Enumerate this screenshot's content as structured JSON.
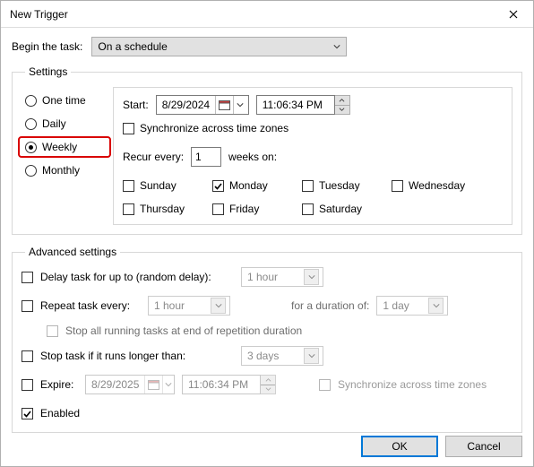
{
  "window": {
    "title": "New Trigger"
  },
  "begin": {
    "label": "Begin the task:",
    "value": "On a schedule"
  },
  "settings": {
    "legend": "Settings",
    "freq": {
      "one_time": "One time",
      "daily": "Daily",
      "weekly": "Weekly",
      "monthly": "Monthly",
      "selected": "weekly"
    },
    "start": {
      "label": "Start:",
      "date": "8/29/2024",
      "time": "11:06:34 PM",
      "sync_label": "Synchronize across time zones",
      "sync_checked": false
    },
    "recur": {
      "label_prefix": "Recur every:",
      "value": "1",
      "label_suffix": "weeks on:"
    },
    "days": {
      "sunday": {
        "label": "Sunday",
        "checked": false
      },
      "monday": {
        "label": "Monday",
        "checked": true
      },
      "tuesday": {
        "label": "Tuesday",
        "checked": false
      },
      "wednesday": {
        "label": "Wednesday",
        "checked": false
      },
      "thursday": {
        "label": "Thursday",
        "checked": false
      },
      "friday": {
        "label": "Friday",
        "checked": false
      },
      "saturday": {
        "label": "Saturday",
        "checked": false
      }
    }
  },
  "advanced": {
    "legend": "Advanced settings",
    "delay": {
      "label": "Delay task for up to (random delay):",
      "value": "1 hour",
      "checked": false
    },
    "repeat": {
      "label": "Repeat task every:",
      "value": "1 hour",
      "checked": false,
      "duration_label": "for a duration of:",
      "duration_value": "1 day"
    },
    "stop_end": {
      "label": "Stop all running tasks at end of repetition duration",
      "checked": false
    },
    "stop_if": {
      "label": "Stop task if it runs longer than:",
      "value": "3 days",
      "checked": false
    },
    "expire": {
      "label": "Expire:",
      "date": "8/29/2025",
      "time": "11:06:34 PM",
      "checked": false,
      "sync_label": "Synchronize across time zones",
      "sync_checked": false
    },
    "enabled": {
      "label": "Enabled",
      "checked": true
    }
  },
  "buttons": {
    "ok": "OK",
    "cancel": "Cancel"
  }
}
